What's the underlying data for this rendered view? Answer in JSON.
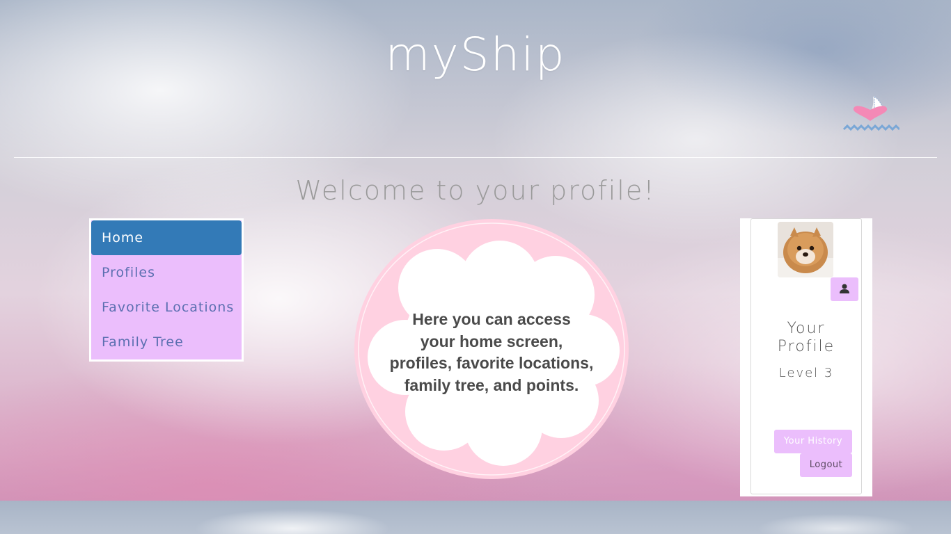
{
  "header": {
    "brand": "myShip",
    "logo_icon": "heart-sailboat-logo"
  },
  "page": {
    "welcome": "Welcome to your profile!"
  },
  "nav": {
    "items": [
      {
        "label": "Home",
        "active": true
      },
      {
        "label": "Profiles",
        "active": false
      },
      {
        "label": "Favorite Locations",
        "active": false
      },
      {
        "label": "Family Tree",
        "active": false
      }
    ]
  },
  "bubble": {
    "lines": [
      "Here you can access",
      "your home screen,",
      "profiles, favorite locations,",
      "family tree, and points."
    ]
  },
  "profile": {
    "title_line1": "Your",
    "title_line2": "Profile",
    "level": "Level 3",
    "user_icon": "user-icon",
    "history_label": "Your History",
    "logout_label": "Logout"
  },
  "colors": {
    "nav_bg": "#ebbefc",
    "nav_active": "#337ab7",
    "bubble_ring": "#ffd1e1",
    "button_bg": "#ebbefc"
  }
}
